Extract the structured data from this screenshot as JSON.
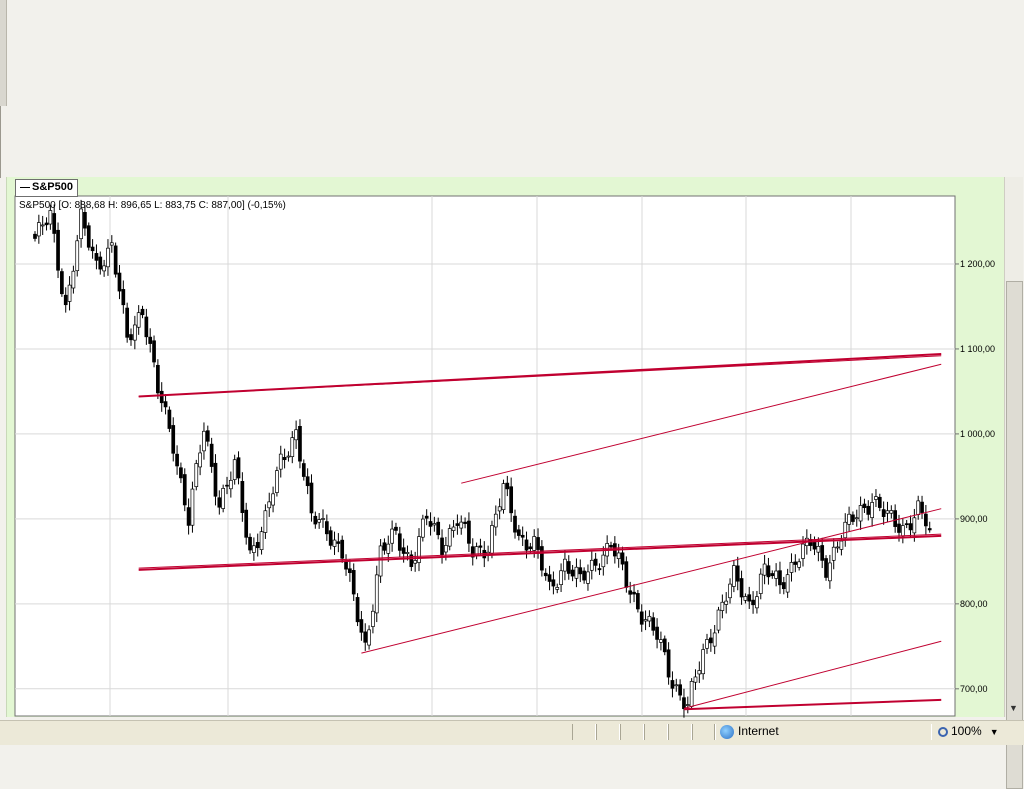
{
  "chart_tab": {
    "label": "S&P500"
  },
  "ohlc_label": "S&P500 [O: 888,68   H: 896,65   L: 883,75   C: 887,00] (-0,15%)",
  "status": {
    "zone": "Internet",
    "zoom": "100%"
  },
  "colors": {
    "up": "#ffffff",
    "down": "#000000",
    "trendline": "#c00030",
    "grid": "#d9d9d9",
    "panel": "#e3f7d3"
  },
  "chart_data": {
    "type": "candlestick",
    "series_name": "S&P500",
    "ylim": [
      668,
      1280
    ],
    "yticks": [
      {
        "value": 700,
        "label": "700,00"
      },
      {
        "value": 800,
        "label": "800,00"
      },
      {
        "value": 900,
        "label": "900,00"
      },
      {
        "value": 1000,
        "label": "1 000,00"
      },
      {
        "value": 1100,
        "label": "1 100,00"
      },
      {
        "value": 1200,
        "label": "1 200,00"
      }
    ],
    "last_bar": {
      "open": 888.68,
      "high": 896.65,
      "low": 883.75,
      "close": 887.0,
      "change_pct": -0.15
    },
    "anchors": [
      {
        "i": 0,
        "v": 1230
      },
      {
        "i": 4,
        "v": 1255
      },
      {
        "i": 8,
        "v": 1150
      },
      {
        "i": 12,
        "v": 1250
      },
      {
        "i": 16,
        "v": 1200
      },
      {
        "i": 20,
        "v": 1220
      },
      {
        "i": 24,
        "v": 1110
      },
      {
        "i": 28,
        "v": 1150
      },
      {
        "i": 32,
        "v": 1050
      },
      {
        "i": 36,
        "v": 990
      },
      {
        "i": 40,
        "v": 900
      },
      {
        "i": 44,
        "v": 1005
      },
      {
        "i": 48,
        "v": 920
      },
      {
        "i": 52,
        "v": 960
      },
      {
        "i": 56,
        "v": 860
      },
      {
        "i": 60,
        "v": 900
      },
      {
        "i": 64,
        "v": 965
      },
      {
        "i": 68,
        "v": 1005
      },
      {
        "i": 72,
        "v": 900
      },
      {
        "i": 76,
        "v": 890
      },
      {
        "i": 80,
        "v": 860
      },
      {
        "i": 84,
        "v": 785
      },
      {
        "i": 86,
        "v": 750
      },
      {
        "i": 90,
        "v": 860
      },
      {
        "i": 94,
        "v": 880
      },
      {
        "i": 98,
        "v": 850
      },
      {
        "i": 102,
        "v": 900
      },
      {
        "i": 106,
        "v": 870
      },
      {
        "i": 110,
        "v": 900
      },
      {
        "i": 114,
        "v": 860
      },
      {
        "i": 118,
        "v": 870
      },
      {
        "i": 122,
        "v": 935
      },
      {
        "i": 126,
        "v": 880
      },
      {
        "i": 130,
        "v": 870
      },
      {
        "i": 134,
        "v": 815
      },
      {
        "i": 138,
        "v": 850
      },
      {
        "i": 142,
        "v": 825
      },
      {
        "i": 146,
        "v": 850
      },
      {
        "i": 150,
        "v": 870
      },
      {
        "i": 154,
        "v": 825
      },
      {
        "i": 158,
        "v": 790
      },
      {
        "i": 162,
        "v": 760
      },
      {
        "i": 166,
        "v": 710
      },
      {
        "i": 170,
        "v": 680
      },
      {
        "i": 174,
        "v": 740
      },
      {
        "i": 178,
        "v": 790
      },
      {
        "i": 182,
        "v": 830
      },
      {
        "i": 186,
        "v": 800
      },
      {
        "i": 190,
        "v": 840
      },
      {
        "i": 194,
        "v": 820
      },
      {
        "i": 198,
        "v": 855
      },
      {
        "i": 202,
        "v": 870
      },
      {
        "i": 206,
        "v": 845
      },
      {
        "i": 210,
        "v": 880
      },
      {
        "i": 214,
        "v": 905
      },
      {
        "i": 218,
        "v": 925
      },
      {
        "i": 222,
        "v": 900
      },
      {
        "i": 226,
        "v": 890
      },
      {
        "i": 230,
        "v": 910
      },
      {
        "i": 233,
        "v": 887
      }
    ],
    "trendlines": [
      {
        "i1": 27,
        "v1": 1044,
        "i2": 236,
        "v2": 1094,
        "width": 2
      },
      {
        "i1": 27,
        "v1": 1044,
        "i2": 236,
        "v2": 1092,
        "width": 1
      },
      {
        "i1": 27,
        "v1": 840,
        "i2": 236,
        "v2": 880,
        "width": 2
      },
      {
        "i1": 27,
        "v1": 842,
        "i2": 236,
        "v2": 882,
        "width": 1
      },
      {
        "i1": 85,
        "v1": 742,
        "i2": 236,
        "v2": 912,
        "width": 1
      },
      {
        "i1": 111,
        "v1": 942,
        "i2": 236,
        "v2": 1082,
        "width": 1
      },
      {
        "i1": 169,
        "v1": 676,
        "i2": 236,
        "v2": 687,
        "width": 2
      },
      {
        "i1": 169,
        "v1": 677,
        "i2": 236,
        "v2": 756,
        "width": 1
      }
    ]
  }
}
